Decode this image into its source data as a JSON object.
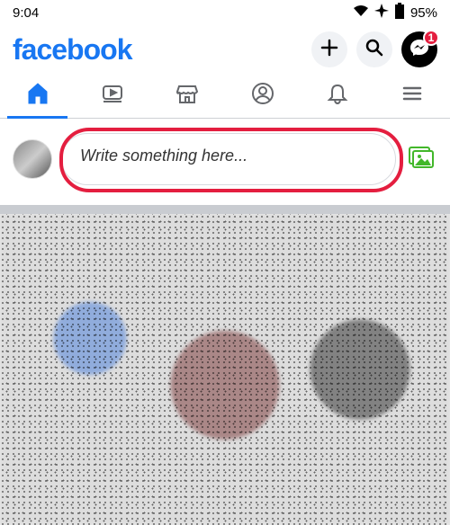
{
  "status": {
    "time": "9:04",
    "battery": "95%"
  },
  "header": {
    "logo": "facebook",
    "badge_count": "1"
  },
  "composer": {
    "placeholder": "Write something here..."
  }
}
